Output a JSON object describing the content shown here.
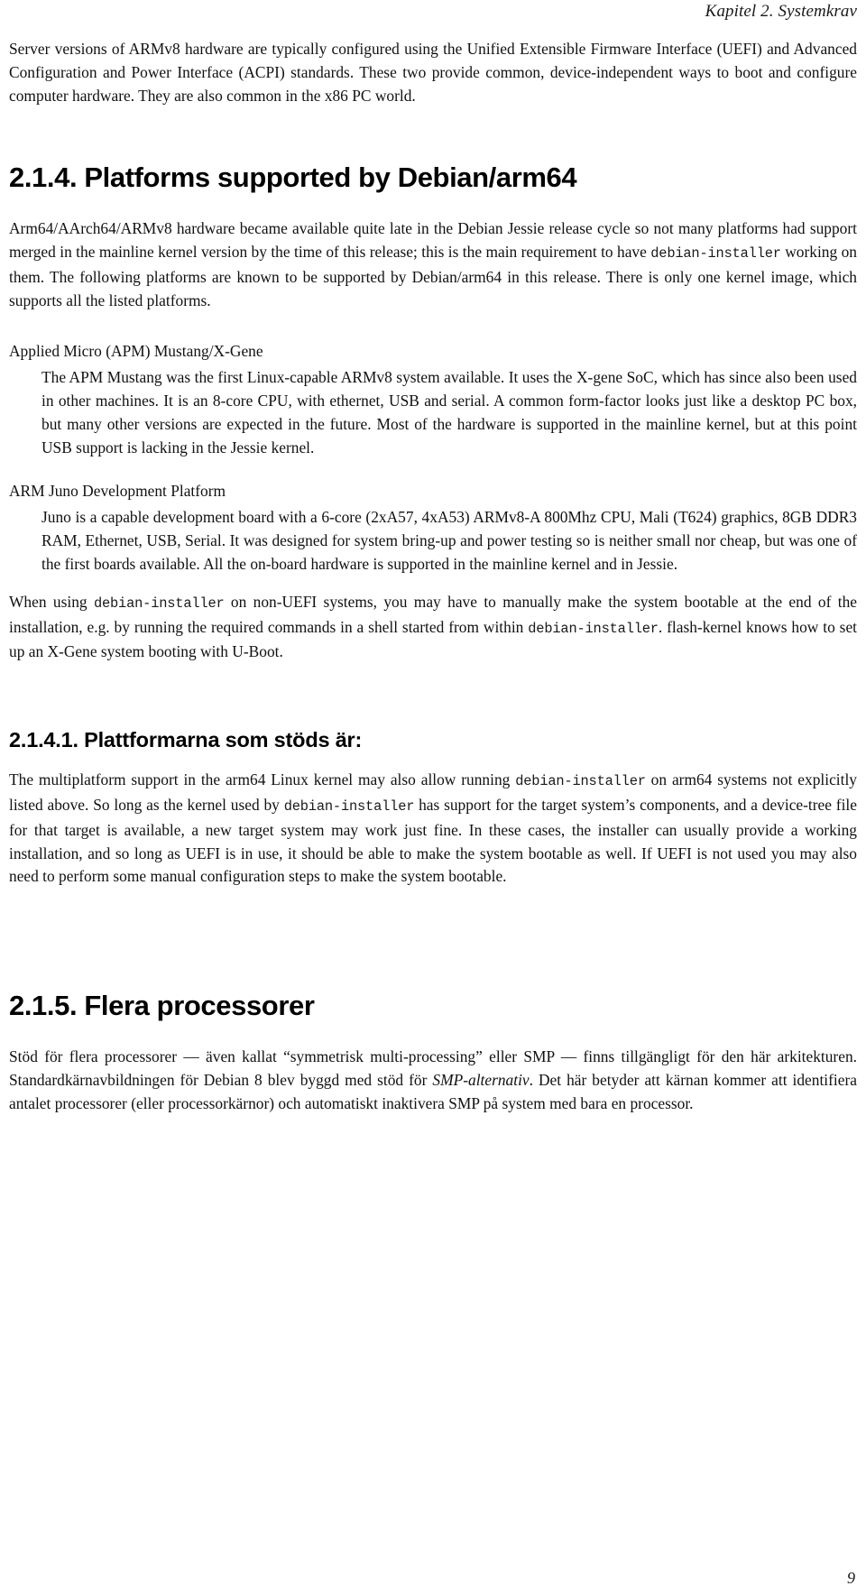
{
  "document": {
    "running_header": "Kapitel 2. Systemkrav",
    "page_number": "9"
  },
  "intro_paragraph": {
    "part1": "Server versions of ARMv8 hardware are typically configured using the Unified Extensible Firmware Interface (UEFI) and Advanced Configuration and Power Interface (ACPI) standards. These two provide common, device-independent ways to boot and configure computer hardware. They are also common in the x86 PC world."
  },
  "section_214": {
    "heading": "2.1.4. Platforms supported by Debian/arm64",
    "intro": {
      "part1": "Arm64/AArch64/ARMv8 hardware became available quite late in the Debian Jessie release cycle so not many platforms had support merged in the mainline kernel version by the time of this release; this is the main requirement to have ",
      "code1": "debian-installer",
      "part2": " working on them. The following platforms are known to be supported by Debian/arm64 in this release. There is only one kernel image, which supports all the listed platforms."
    },
    "platforms": [
      {
        "term": "Applied Micro (APM) Mustang/X-Gene",
        "definition": "The APM Mustang was the first Linux-capable ARMv8 system available. It uses the X-gene SoC, which has since also been used in other machines. It is an 8-core CPU, with ethernet, USB and serial. A common form-factor looks just like a desktop PC box, but many other versions are expected in the future. Most of the hardware is supported in the mainline kernel, but at this point USB support is lacking in the Jessie kernel."
      },
      {
        "term": "ARM Juno Development Platform",
        "definition": "Juno is a capable development board with a 6-core (2xA57, 4xA53) ARMv8-A 800Mhz CPU, Mali (T624) graphics, 8GB DDR3 RAM, Ethernet, USB, Serial. It was designed for system bring-up and power testing so is neither small nor cheap, but was one of the first boards available. All the on-board hardware is supported in the mainline kernel and in Jessie."
      }
    ],
    "closing": {
      "part1": "When using ",
      "code1": "debian-installer",
      "part2": " on non-UEFI systems, you may have to manually make the system bootable at the end of the installation, e.g. by running the required commands in a shell started from within ",
      "code2": "debian-installer",
      "part3": ". flash-kernel knows how to set up an X-Gene system booting with U-Boot."
    }
  },
  "section_2141": {
    "heading": "2.1.4.1. Plattformarna som stöds är:",
    "paragraph": {
      "part1": "The multiplatform support in the arm64 Linux kernel may also allow running ",
      "code1": "debian-installer",
      "part2": " on arm64 systems not explicitly listed above. So long as the kernel used by ",
      "code2": "debian-installer",
      "part3": " has support for the target system’s components, and a device-tree file for that target is available, a new target system may work just fine. In these cases, the installer can usually provide a working installation, and so long as UEFI is in use, it should be able to make the system bootable as well. If UEFI is not used you may also need to perform some manual configuration steps to make the system bootable."
    }
  },
  "section_215": {
    "heading": "2.1.5. Flera processorer",
    "paragraph": {
      "part1": "Stöd för flera processorer — även kallat “symmetrisk multi-processing” eller SMP — finns tillgängligt för den här arkitekturen. Standardkärnavbildningen för Debian 8 blev byggd med stöd för ",
      "emph1": "SMP-alternativ",
      "part2": ". Det här betyder att kärnan kommer att identifiera antalet processorer (eller processorkärnor) och automatiskt inaktivera SMP på system med bara en processor."
    }
  }
}
